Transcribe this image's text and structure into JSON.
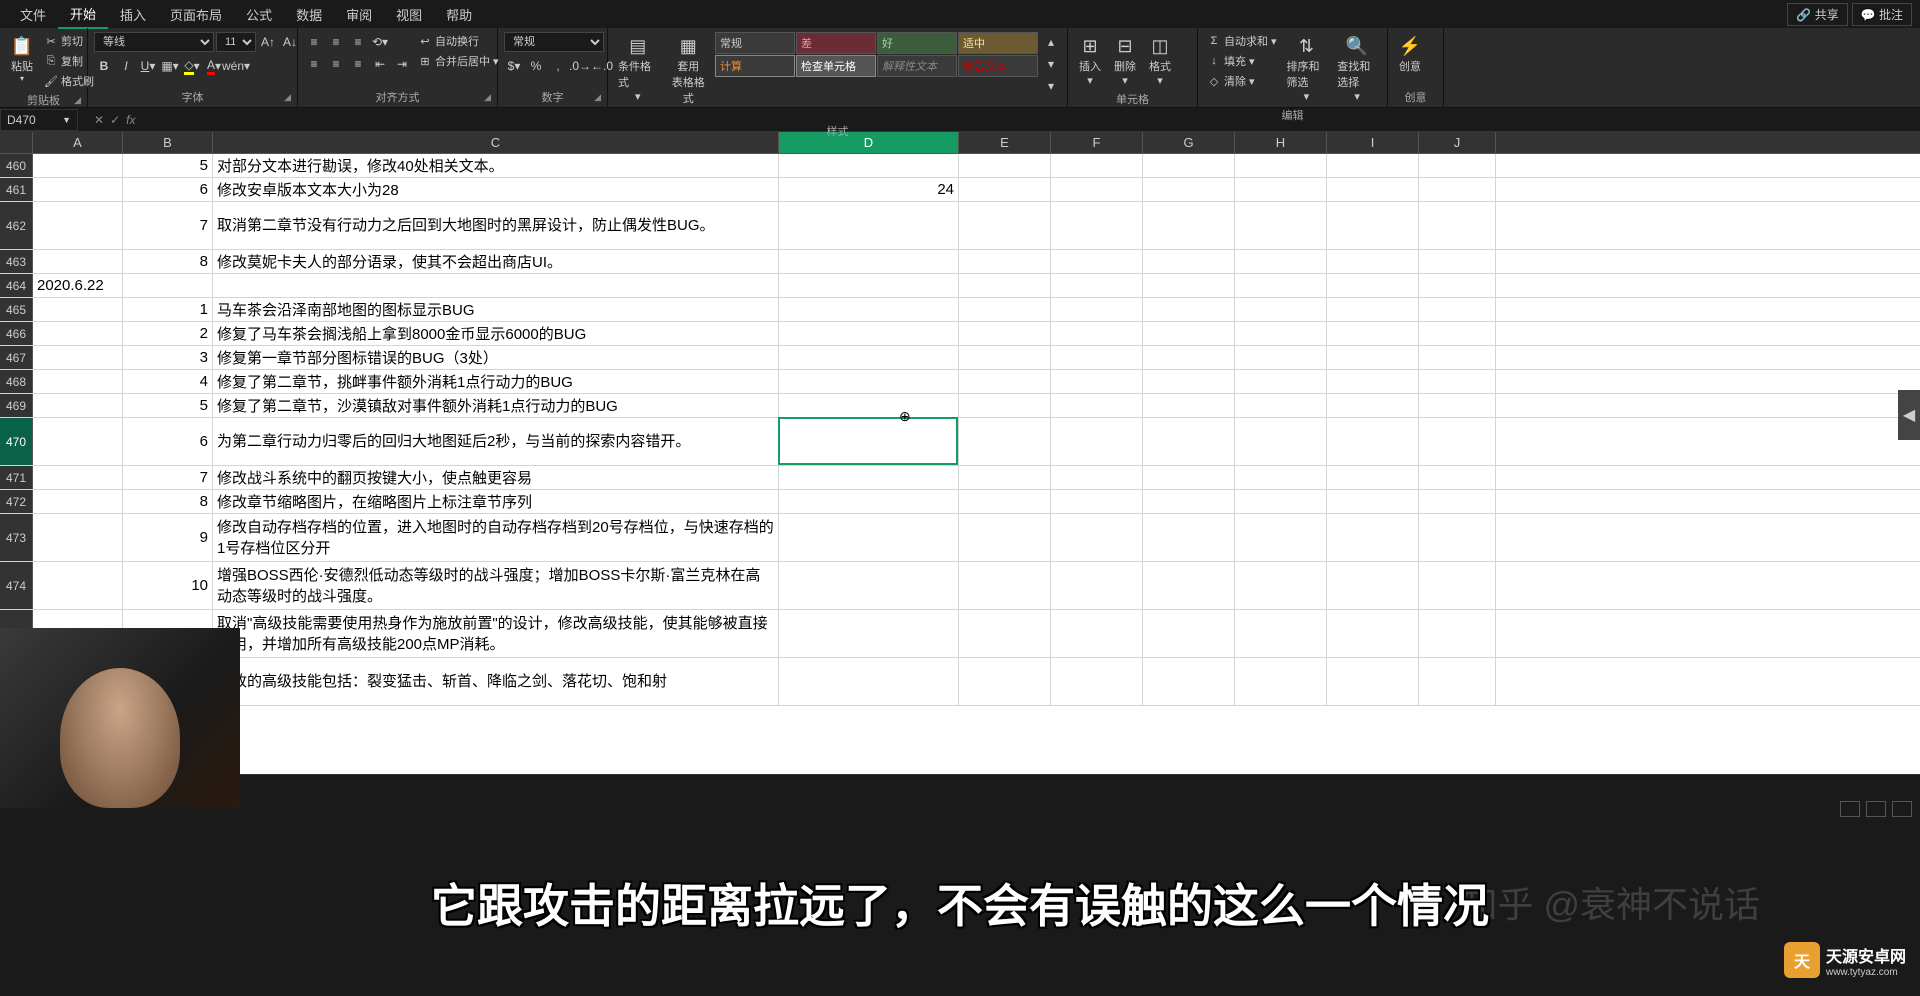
{
  "tabs": [
    "文件",
    "开始",
    "插入",
    "页面布局",
    "公式",
    "数据",
    "审阅",
    "视图",
    "帮助"
  ],
  "active_tab": 1,
  "share_btn": "共享",
  "comment_btn": "批注",
  "ribbon": {
    "clipboard": {
      "paste": "粘贴",
      "cut": "剪切",
      "copy": "复制",
      "fmt": "格式刷",
      "label": "剪贴板"
    },
    "font": {
      "name": "等线",
      "size": "11",
      "label": "字体"
    },
    "align": {
      "wrap": "自动换行",
      "merge": "合并后居中",
      "label": "对齐方式"
    },
    "number": {
      "fmt": "常规",
      "label": "数字"
    },
    "styles": {
      "cond": "条件格式",
      "table": "套用\n表格格式",
      "label": "样式",
      "cells": [
        {
          "t": "常规",
          "bg": "#3a3a3a",
          "fg": "#ccc"
        },
        {
          "t": "差",
          "bg": "#6b2d35",
          "fg": "#ea9999"
        },
        {
          "t": "好",
          "bg": "#3d5b3d",
          "fg": "#a4d4a4"
        },
        {
          "t": "适中",
          "bg": "#6b5a32",
          "fg": "#ffe599"
        },
        {
          "t": "计算",
          "bg": "#3a3a3a",
          "fg": "#e69138",
          "bd": "#888"
        },
        {
          "t": "检查单元格",
          "bg": "#555",
          "fg": "#fff",
          "bd": "#888"
        },
        {
          "t": "解释性文本",
          "bg": "#3a3a3a",
          "fg": "#888",
          "it": true
        },
        {
          "t": "警告文本",
          "bg": "#3a3a3a",
          "fg": "#cc0000"
        }
      ]
    },
    "cells": {
      "insert": "插入",
      "delete": "删除",
      "format": "格式",
      "label": "单元格"
    },
    "editing": {
      "sum": "自动求和",
      "fill": "填充",
      "clear": "清除",
      "sort": "排序和筛选",
      "find": "查找和选择",
      "label": "编辑"
    },
    "ideas": {
      "btn": "创意",
      "label": "创意"
    }
  },
  "name_box": "D470",
  "columns": [
    "A",
    "B",
    "C",
    "D",
    "E",
    "F",
    "G",
    "H",
    "I",
    "J"
  ],
  "active_col": 3,
  "rows": [
    {
      "n": "460",
      "B": "5",
      "C": "对部分文本进行勘误，修改40处相关文本。"
    },
    {
      "n": "461",
      "B": "6",
      "C": "修改安卓版本文本大小为28",
      "D": "24"
    },
    {
      "n": "462",
      "B": "7",
      "C": "取消第二章节没有行动力之后回到大地图时的黑屏设计，防止偶发性BUG。",
      "multi": true
    },
    {
      "n": "463",
      "B": "8",
      "C": "修改莫妮卡夫人的部分语录，使其不会超出商店UI。"
    },
    {
      "n": "464",
      "A": "2020.6.22"
    },
    {
      "n": "465",
      "B": "1",
      "C": "马车茶会沿泽南部地图的图标显示BUG"
    },
    {
      "n": "466",
      "B": "2",
      "C": "修复了马车茶会搁浅船上拿到8000金币显示6000的BUG"
    },
    {
      "n": "467",
      "B": "3",
      "C": "修复第一章节部分图标错误的BUG（3处）"
    },
    {
      "n": "468",
      "B": "4",
      "C": "修复了第二章节，挑衅事件额外消耗1点行动力的BUG"
    },
    {
      "n": "469",
      "B": "5",
      "C": "修复了第二章节，沙漠镇敌对事件额外消耗1点行动力的BUG"
    },
    {
      "n": "470",
      "B": "6",
      "C": "为第二章行动力归零后的回归大地图延后2秒，与当前的探索内容错开。",
      "multi": true,
      "active": true
    },
    {
      "n": "471",
      "B": "7",
      "C": "修改战斗系统中的翻页按键大小，使点触更容易"
    },
    {
      "n": "472",
      "B": "8",
      "C": "修改章节缩略图片，在缩略图片上标注章节序列"
    },
    {
      "n": "473",
      "B": "9",
      "C": "修改自动存档存档的位置，进入地图时的自动存档存档到20号存档位，与快速存档的1号存档位区分开",
      "multi": true
    },
    {
      "n": "474",
      "B": "10",
      "C": "增强BOSS西伦·安德烈低动态等级时的战斗强度；增加BOSS卡尔斯·富兰克林在高动态等级时的战斗强度。",
      "multi": true
    },
    {
      "n": "",
      "C": "取消\"高级技能需要使用热身作为施放前置\"的设计，修改高级技能，使其能够被直接使用，并增加所有高级技能200点MP消耗。",
      "multi": true
    },
    {
      "n": "",
      "C": "修改的高级技能包括：裂变猛击、斩首、降临之剑、落花切、饱和射",
      "multi": true
    }
  ],
  "subtitle": "它跟攻击的距离拉远了，不会有误触的这么一个情况",
  "watermark1": "知乎 @衰神不说话",
  "watermark2": {
    "name": "天源安卓网",
    "url": "www.tytyaz.com"
  }
}
